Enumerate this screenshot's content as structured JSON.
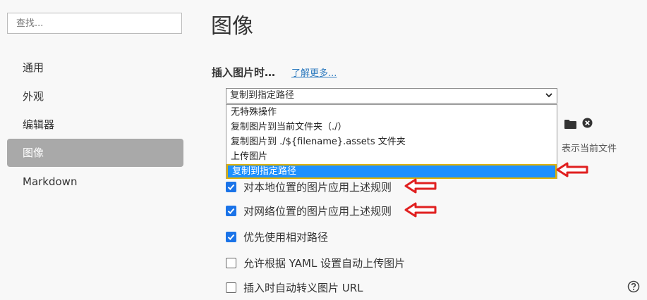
{
  "sidebar": {
    "search_placeholder": "查找...",
    "items": [
      {
        "label": "通用"
      },
      {
        "label": "外观"
      },
      {
        "label": "编辑器"
      },
      {
        "label": "图像",
        "active": true
      },
      {
        "label": "Markdown"
      }
    ]
  },
  "main": {
    "title": "图像",
    "insert_label": "插入图片时…",
    "learn_more": "了解更多...",
    "select_value": "复制到指定路径",
    "dropdown_options": [
      "无特殊操作",
      "复制图片到当前文件夹（./）",
      "复制图片到 ./${filename}.assets 文件夹",
      "上传图片",
      "复制到指定路径"
    ],
    "selected_index": 4,
    "current_file_note": "表示当前文件",
    "checkboxes": [
      {
        "label": "对本地位置的图片应用上述规则",
        "checked": true
      },
      {
        "label": "对网络位置的图片应用上述规则",
        "checked": true
      },
      {
        "label": "优先使用相对路径",
        "checked": true
      },
      {
        "label": "允许根据 YAML 设置自动上传图片",
        "checked": false
      },
      {
        "label": "插入时自动转义图片 URL",
        "checked": false
      }
    ]
  },
  "colors": {
    "accent": "#1a73e8",
    "highlight": "#1e90ff",
    "annotation_arrow": "#e02020"
  },
  "icons": [
    "folder-icon",
    "clear-icon",
    "help-icon",
    "check-icon",
    "chevron-down-icon",
    "annotation-arrow-icon"
  ]
}
